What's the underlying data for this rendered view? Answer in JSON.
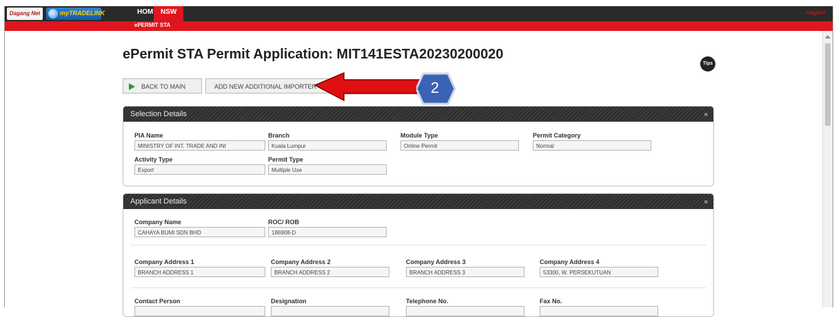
{
  "header": {
    "logo_text": "myTRADELINK",
    "nav": [
      {
        "label": "HOME"
      },
      {
        "label": "NSW"
      }
    ],
    "sub_nav": "ePERMIT STA",
    "user": "mbgtest"
  },
  "page": {
    "title": "ePermit STA Permit Application: MIT141ESTA20230200020",
    "tips_label": "Tips",
    "buttons": {
      "back": "BACK TO MAIN",
      "add": "ADD NEW ADDITIONAL IMPORTER"
    }
  },
  "annotation": {
    "badge": "2",
    "arrow_color": "#e01010",
    "badge_color": "#3a63b5"
  },
  "selection": {
    "heading": "Selection Details",
    "fields": [
      {
        "label": "PIA Name",
        "value": "MINISTRY OF INT. TRADE AND INI"
      },
      {
        "label": "Branch",
        "value": "Kuala Lumpur"
      },
      {
        "label": "Module Type",
        "value": "Online Permit"
      },
      {
        "label": "Permit Category",
        "value": "Normal"
      },
      {
        "label": "Activity Type",
        "value": "Export"
      },
      {
        "label": "Permit Type",
        "value": "Multiple Use"
      }
    ]
  },
  "applicant": {
    "heading": "Applicant Details",
    "fields": [
      {
        "label": "Company Name",
        "value": "CAHAYA BUMI SDN BHD"
      },
      {
        "label": "ROC/ ROB",
        "value": "186908-D"
      },
      {
        "label": "Company Address 1",
        "value": "BRANCH ADDRESS 1"
      },
      {
        "label": "Company Address 2",
        "value": "BRANCH  ADDRESS 2"
      },
      {
        "label": "Company Address 3",
        "value": "BRANCH  ADDRESS 3"
      },
      {
        "label": "Company Address 4",
        "value": "53300, W. PERSEKUTUAN"
      },
      {
        "label": "Contact Person",
        "value": ""
      },
      {
        "label": "Designation",
        "value": ""
      },
      {
        "label": "Telephone No.",
        "value": ""
      },
      {
        "label": "Fax No.",
        "value": ""
      }
    ]
  },
  "colors": {
    "nav_red": "#e0161e",
    "header_dark": "#2a2a2a"
  }
}
